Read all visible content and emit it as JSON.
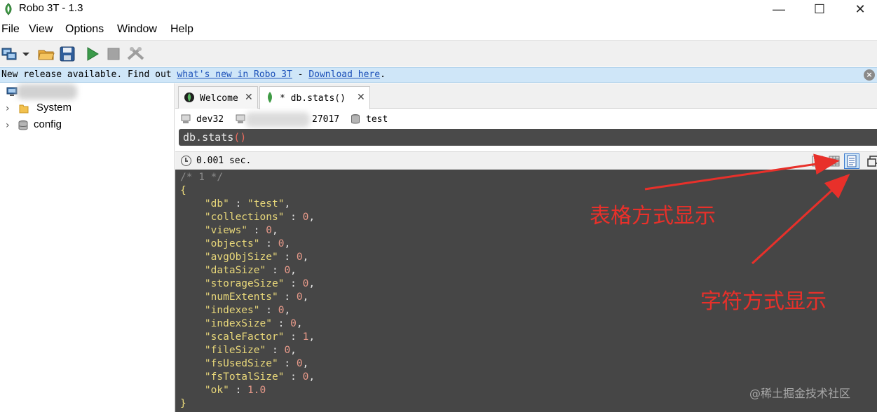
{
  "window": {
    "title": "Robo 3T - 1.3",
    "minimize": "—",
    "maximize": "☐",
    "close": "✕"
  },
  "menu": [
    "File",
    "View",
    "Options",
    "Window",
    "Help"
  ],
  "infobar": {
    "prefix": "New release available. Find out ",
    "link1": "what's new in Robo 3T",
    "sep": " - ",
    "link2": "Download here",
    "suffix": "."
  },
  "sidebar": {
    "items": [
      {
        "label": "System",
        "icon": "folder-icon"
      },
      {
        "label": "config",
        "icon": "database-icon"
      }
    ]
  },
  "tabs": [
    {
      "label": "Welcome",
      "close": "✕"
    },
    {
      "label": "* db.stats()",
      "close": "✕"
    }
  ],
  "connection": {
    "server": "dev32",
    "port": "27017",
    "database": "test"
  },
  "query": {
    "text": "db.stats",
    "parens": "()"
  },
  "result": {
    "time": "0.001 sec."
  },
  "document": {
    "comment": "/* 1 */",
    "open": "{",
    "close": "}",
    "fields": [
      {
        "key": "\"db\"",
        "value": "\"test\"",
        "type": "string"
      },
      {
        "key": "\"collections\"",
        "value": "0",
        "type": "number"
      },
      {
        "key": "\"views\"",
        "value": "0",
        "type": "number"
      },
      {
        "key": "\"objects\"",
        "value": "0",
        "type": "number"
      },
      {
        "key": "\"avgObjSize\"",
        "value": "0",
        "type": "number"
      },
      {
        "key": "\"dataSize\"",
        "value": "0",
        "type": "number"
      },
      {
        "key": "\"storageSize\"",
        "value": "0",
        "type": "number"
      },
      {
        "key": "\"numExtents\"",
        "value": "0",
        "type": "number"
      },
      {
        "key": "\"indexes\"",
        "value": "0",
        "type": "number"
      },
      {
        "key": "\"indexSize\"",
        "value": "0",
        "type": "number"
      },
      {
        "key": "\"scaleFactor\"",
        "value": "1",
        "type": "number"
      },
      {
        "key": "\"fileSize\"",
        "value": "0",
        "type": "number"
      },
      {
        "key": "\"fsUsedSize\"",
        "value": "0",
        "type": "number"
      },
      {
        "key": "\"fsTotalSize\"",
        "value": "0",
        "type": "number"
      },
      {
        "key": "\"ok\"",
        "value": "1.0",
        "type": "number"
      }
    ]
  },
  "annotations": {
    "table_view": "表格方式显示",
    "text_view": "字符方式显示"
  },
  "watermark": "@稀土掘金技术社区",
  "colors": {
    "accent": "#e8302a",
    "editor_bg": "#464646",
    "infobar_bg": "#cfe6f8",
    "link": "#1a4fb8"
  }
}
